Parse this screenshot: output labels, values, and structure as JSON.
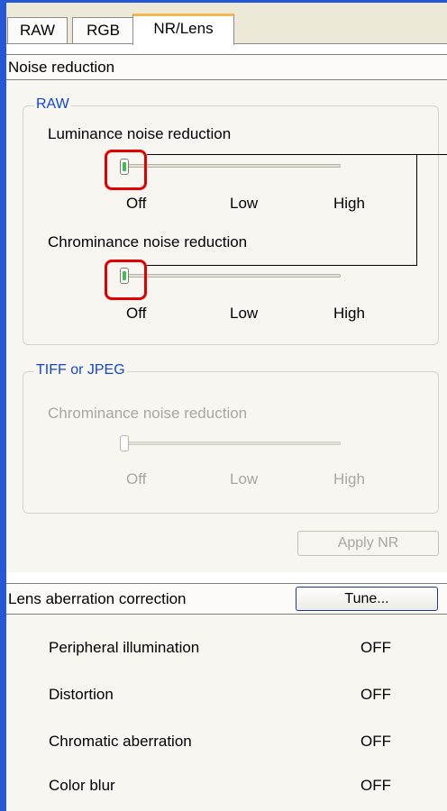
{
  "tabs": [
    {
      "label": "RAW"
    },
    {
      "label": "RGB"
    },
    {
      "label": "NR/Lens"
    }
  ],
  "noise_reduction": {
    "header": "Noise reduction",
    "raw_group": {
      "title": "RAW",
      "luminance": {
        "label": "Luminance noise reduction",
        "value": "Off"
      },
      "chrominance": {
        "label": "Chrominance noise reduction",
        "value": "Off"
      },
      "ticks": {
        "off": "Off",
        "low": "Low",
        "high": "High"
      }
    },
    "tiff_group": {
      "title": "TIFF or JPEG",
      "chrominance": {
        "label": "Chrominance noise reduction",
        "value": "Off"
      },
      "ticks": {
        "off": "Off",
        "low": "Low",
        "high": "High"
      }
    },
    "apply_button": "Apply NR"
  },
  "lens": {
    "header": "Lens aberration correction",
    "tune_button": "Tune...",
    "rows": [
      {
        "label": "Peripheral illumination",
        "value": "OFF"
      },
      {
        "label": "Distortion",
        "value": "OFF"
      },
      {
        "label": "Chromatic aberration",
        "value": "OFF"
      },
      {
        "label": "Color blur",
        "value": "OFF"
      }
    ]
  },
  "colors": {
    "group_title": "#0f47d4",
    "highlight": "#e00000",
    "active_tab_accent": "#f5b64b",
    "slider_grip": "#3fbd53"
  }
}
